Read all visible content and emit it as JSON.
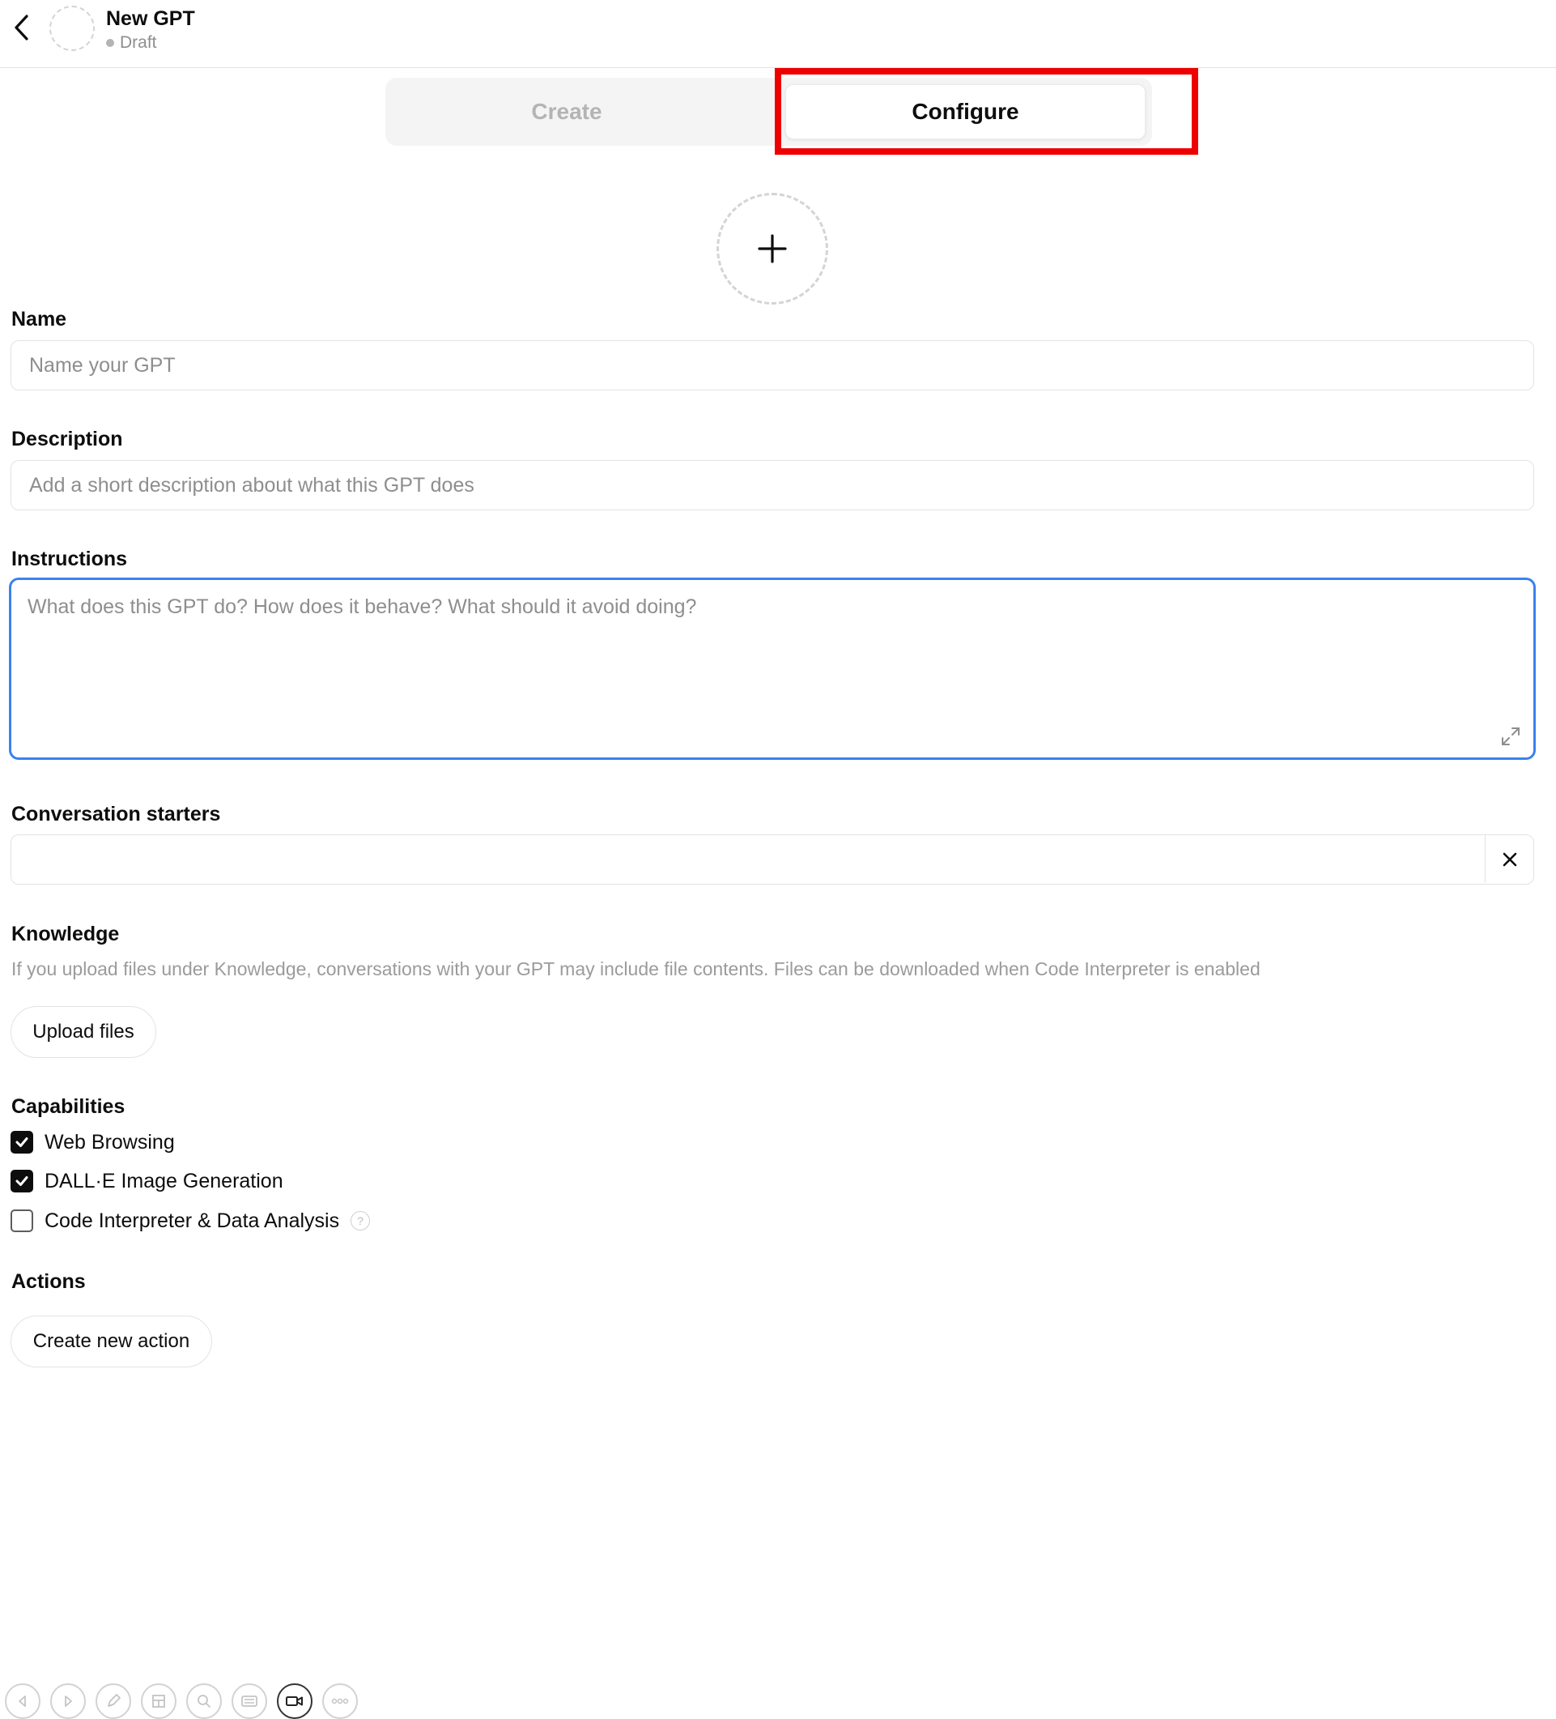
{
  "header": {
    "title": "New GPT",
    "status": "Draft"
  },
  "tabs": [
    {
      "label": "Create",
      "active": false
    },
    {
      "label": "Configure",
      "active": true
    }
  ],
  "form": {
    "name": {
      "label": "Name",
      "placeholder": "Name your GPT",
      "value": ""
    },
    "description": {
      "label": "Description",
      "placeholder": "Add a short description about what this GPT does",
      "value": ""
    },
    "instructions": {
      "label": "Instructions",
      "placeholder": "What does this GPT do? How does it behave? What should it avoid doing?",
      "value": ""
    },
    "conversation_starters": {
      "label": "Conversation starters",
      "items": [
        ""
      ]
    },
    "knowledge": {
      "label": "Knowledge",
      "help": "If you upload files under Knowledge, conversations with your GPT may include file contents. Files can be downloaded when Code Interpreter is enabled",
      "upload_label": "Upload files"
    },
    "capabilities": {
      "label": "Capabilities",
      "items": [
        {
          "label": "Web Browsing",
          "checked": true
        },
        {
          "label": "DALL·E Image Generation",
          "checked": true
        },
        {
          "label": "Code Interpreter & Data Analysis",
          "checked": false
        }
      ]
    },
    "actions": {
      "label": "Actions",
      "button_label": "Create new action"
    }
  },
  "toolbar": {
    "items": [
      "back-icon",
      "forward-icon",
      "pen-icon",
      "layout-icon",
      "search-icon",
      "keyboard-icon",
      "video-camera-icon",
      "more-icon"
    ],
    "active": "video-camera-icon"
  },
  "colors": {
    "focus_border": "#3a82ef",
    "highlight": "#ee0000",
    "muted_text": "#8e8e8e"
  }
}
